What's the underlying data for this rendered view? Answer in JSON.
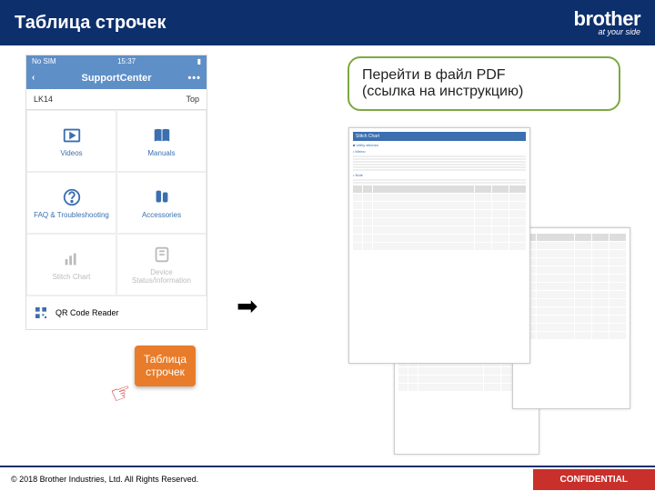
{
  "header": {
    "title": "Таблица строчек",
    "brand": "brother",
    "tagline": "at your side"
  },
  "phone": {
    "status": {
      "left": "No SIM",
      "center": "15:37",
      "right_icon": "battery-icon"
    },
    "app_title": "SupportCenter",
    "back_icon": "chevron-left-icon",
    "menu_icon": "more-icon",
    "crumb_left": "LK14",
    "crumb_right": "Top",
    "tiles": [
      {
        "label": "Videos",
        "icon": "video-icon"
      },
      {
        "label": "Manuals",
        "icon": "book-icon"
      },
      {
        "label": "FAQ & Troubleshooting",
        "icon": "question-icon"
      },
      {
        "label": "Accessories",
        "icon": "accessories-icon"
      },
      {
        "label": "Stitch Chart",
        "icon": "chart-icon",
        "dim": true
      },
      {
        "label": "Device Status/Information",
        "icon": "device-icon",
        "dim": true
      }
    ],
    "qr_label": "QR Code Reader"
  },
  "callout": {
    "line1": "Таблица",
    "line2": "строчек"
  },
  "pointer_icon": "hand-pointer-icon",
  "arrow_icon": "arrow-right-icon",
  "link_box": {
    "line1": "Перейти в файл PDF",
    "line2": "(ссылка на инструкцию)"
  },
  "pdf": {
    "heading": "Stitch Chart",
    "sub1": "Utility stitches",
    "sub2": "Memo",
    "sub3": "Note"
  },
  "footer": {
    "copyright": "© 2018 Brother Industries, Ltd. All Rights Reserved.",
    "confidential": "CONFIDENTIAL"
  }
}
